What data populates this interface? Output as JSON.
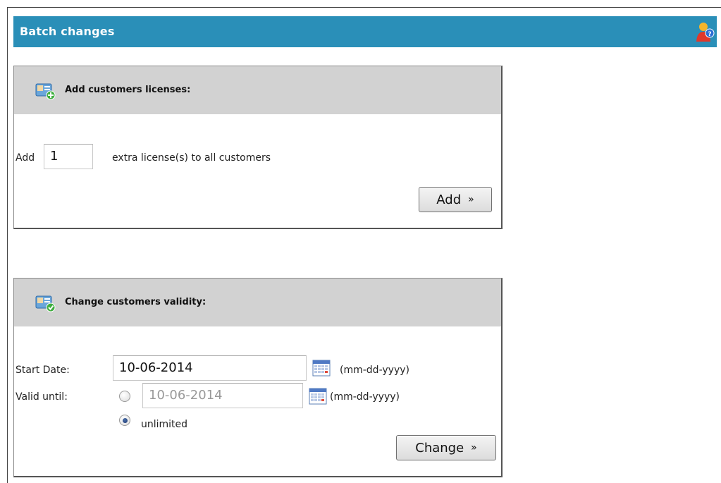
{
  "header": {
    "title": "Batch changes",
    "icon": "help-person-icon"
  },
  "add_licenses": {
    "title": "Add customers licenses:",
    "icon": "add-user-icon",
    "prefix_label": "Add",
    "count_value": "1",
    "suffix_label": "extra license(s) to all customers",
    "button_label": "Add",
    "button_arrow": "»"
  },
  "validity": {
    "title": "Change customers validity:",
    "icon": "validate-user-icon",
    "start_label": "Start Date:",
    "start_value": "10-06-2014",
    "start_format": "(mm-dd-yyyy)",
    "valid_label": "Valid until:",
    "valid_value": "10-06-2014",
    "valid_format": "(mm-dd-yyyy)",
    "unlimited_label": "unlimited",
    "selected_option": "unlimited",
    "button_label": "Change",
    "button_arrow": "»"
  },
  "colors": {
    "header_bg": "#2a8fb8",
    "panel_head_bg": "#d2d2d2"
  }
}
